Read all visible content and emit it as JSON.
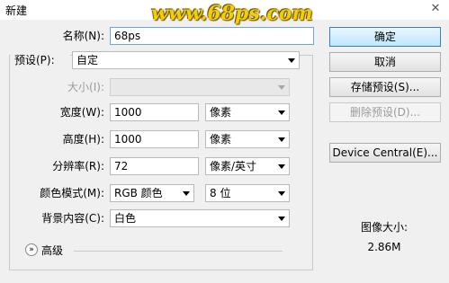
{
  "window": {
    "title": "新建",
    "close_glyph": "✕"
  },
  "watermark": "www.68ps.com",
  "name": {
    "label": "名称(N):",
    "value": "68ps"
  },
  "preset": {
    "label": "预设(P):",
    "value": "自定"
  },
  "size": {
    "label": "大小(I):",
    "value": ""
  },
  "width": {
    "label": "宽度(W):",
    "value": "1000",
    "unit": "像素"
  },
  "height": {
    "label": "高度(H):",
    "value": "1000",
    "unit": "像素"
  },
  "resolution": {
    "label": "分辨率(R):",
    "value": "72",
    "unit": "像素/英寸"
  },
  "color_mode": {
    "label": "颜色模式(M):",
    "value": "RGB 颜色",
    "depth": "8 位"
  },
  "background": {
    "label": "背景内容(C):",
    "value": "白色"
  },
  "advanced": {
    "label": "高级",
    "icon": "expand-chevron-icon"
  },
  "buttons": {
    "ok": "确定",
    "cancel": "取消",
    "save_preset": "存储预设(S)...",
    "delete_preset": "删除预设(D)...",
    "device_central": "Device Central(E)..."
  },
  "image_size": {
    "label": "图像大小:",
    "value": "2.86M"
  },
  "colors": {
    "default_button": "#bee6fd",
    "watermark": "#f2d000",
    "disabled_text": "#9a9a9a"
  }
}
